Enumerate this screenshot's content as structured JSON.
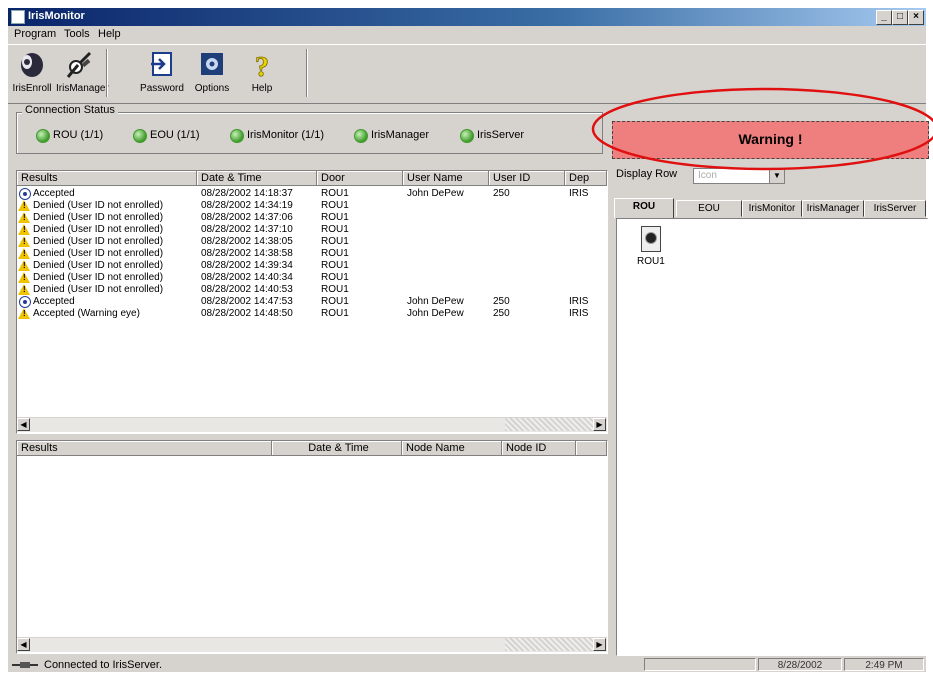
{
  "window": {
    "title": "IrisMonitor",
    "controls": [
      "_",
      "□",
      "×"
    ]
  },
  "menu": [
    "Program",
    "Tools",
    "Help"
  ],
  "toolbar": [
    {
      "label": "IrisEnroll",
      "icon": "eye-icon"
    },
    {
      "label": "IrisManager",
      "icon": "manager-tools-icon"
    },
    {
      "label": "Password",
      "icon": "password-icon"
    },
    {
      "label": "Options",
      "icon": "options-gear-icon"
    },
    {
      "label": "Help",
      "icon": "help-question-icon"
    }
  ],
  "connection": {
    "legend": "Connection Status",
    "items": [
      {
        "label": "ROU (1/1)",
        "status_color": "#3e9b2a"
      },
      {
        "label": "EOU (1/1)",
        "status_color": "#3e9b2a"
      },
      {
        "label": "IrisMonitor (1/1)",
        "status_color": "#3e9b2a"
      },
      {
        "label": "IrisManager",
        "status_color": "#3e9b2a"
      },
      {
        "label": "IrisServer",
        "status_color": "#3e9b2a"
      }
    ]
  },
  "warning": {
    "text": "Warning !",
    "background": "#ef7f7f",
    "annotation_color": "#e01010"
  },
  "results_table": {
    "columns": [
      "Results",
      "Date & Time",
      "Door",
      "User Name",
      "User ID",
      "Dep"
    ],
    "rows": [
      {
        "icon": "accepted-icon",
        "result": "Accepted",
        "datetime": "08/28/2002 14:18:37",
        "door": "ROU1",
        "user": "John DePew",
        "id": "250",
        "dep": "IRIS"
      },
      {
        "icon": "warning-icon",
        "result": "Denied (User ID not enrolled)",
        "datetime": "08/28/2002 14:34:19",
        "door": "ROU1",
        "user": "",
        "id": "",
        "dep": ""
      },
      {
        "icon": "warning-icon",
        "result": "Denied (User ID not enrolled)",
        "datetime": "08/28/2002 14:37:06",
        "door": "ROU1",
        "user": "",
        "id": "",
        "dep": ""
      },
      {
        "icon": "warning-icon",
        "result": "Denied (User ID not enrolled)",
        "datetime": "08/28/2002 14:37:10",
        "door": "ROU1",
        "user": "",
        "id": "",
        "dep": ""
      },
      {
        "icon": "warning-icon",
        "result": "Denied (User ID not enrolled)",
        "datetime": "08/28/2002 14:38:05",
        "door": "ROU1",
        "user": "",
        "id": "",
        "dep": ""
      },
      {
        "icon": "warning-icon",
        "result": "Denied (User ID not enrolled)",
        "datetime": "08/28/2002 14:38:58",
        "door": "ROU1",
        "user": "",
        "id": "",
        "dep": ""
      },
      {
        "icon": "warning-icon",
        "result": "Denied (User ID not enrolled)",
        "datetime": "08/28/2002 14:39:34",
        "door": "ROU1",
        "user": "",
        "id": "",
        "dep": ""
      },
      {
        "icon": "warning-icon",
        "result": "Denied (User ID not enrolled)",
        "datetime": "08/28/2002 14:40:34",
        "door": "ROU1",
        "user": "",
        "id": "",
        "dep": ""
      },
      {
        "icon": "warning-icon",
        "result": "Denied (User ID not enrolled)",
        "datetime": "08/28/2002 14:40:53",
        "door": "ROU1",
        "user": "",
        "id": "",
        "dep": ""
      },
      {
        "icon": "accepted-icon",
        "result": "Accepted",
        "datetime": "08/28/2002 14:47:53",
        "door": "ROU1",
        "user": "John DePew",
        "id": "250",
        "dep": "IRIS"
      },
      {
        "icon": "warning-icon",
        "result": "Accepted (Warning eye)",
        "datetime": "08/28/2002 14:48:50",
        "door": "ROU1",
        "user": "John DePew",
        "id": "250",
        "dep": "IRIS"
      }
    ]
  },
  "node_table": {
    "columns": [
      "Results",
      "Date & Time",
      "Node Name",
      "Node ID"
    ]
  },
  "display": {
    "label": "Display Row",
    "value": "Icon"
  },
  "tabs": [
    {
      "label": "ROU",
      "active": true
    },
    {
      "label": "EOU",
      "active": false
    },
    {
      "label": "IrisMonitor",
      "active": false
    },
    {
      "label": "IrisManager",
      "active": false
    },
    {
      "label": "IrisServer",
      "active": false
    }
  ],
  "devices": [
    {
      "label": "ROU1",
      "icon": "rou-device-icon"
    }
  ],
  "statusbar": {
    "message": "Connected to IrisServer.",
    "date": "8/28/2002",
    "time": "2:49 PM"
  }
}
